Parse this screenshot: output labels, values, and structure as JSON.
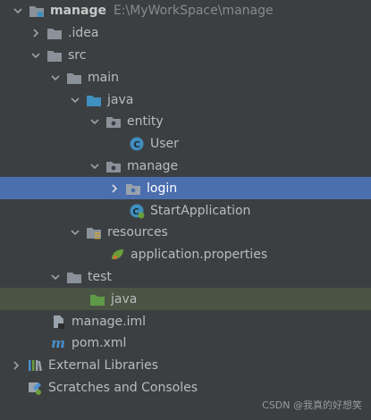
{
  "tree": {
    "root": {
      "label": "manage",
      "path": "E:\\MyWorkSpace\\manage"
    },
    "idea": {
      "label": ".idea"
    },
    "src": {
      "label": "src"
    },
    "main": {
      "label": "main"
    },
    "java": {
      "label": "java"
    },
    "entity": {
      "label": "entity"
    },
    "user": {
      "label": "User"
    },
    "manage_pkg": {
      "label": "manage"
    },
    "login": {
      "label": "login"
    },
    "start_app": {
      "label": "StartApplication"
    },
    "resources": {
      "label": "resources"
    },
    "app_props": {
      "label": "application.properties"
    },
    "test": {
      "label": "test"
    },
    "test_java": {
      "label": "java"
    },
    "manage_iml": {
      "label": "manage.iml"
    },
    "pom": {
      "label": "pom.xml"
    },
    "ext_libs": {
      "label": "External Libraries"
    },
    "scratches": {
      "label": "Scratches and Consoles"
    }
  },
  "watermark": "CSDN @我真的好想笑",
  "colors": {
    "background": "#3c3f41",
    "selection": "#4b6eaf",
    "highlight": "#4a5444",
    "folder": "#8a9199",
    "source_folder": "#3f8fc0",
    "test_folder": "#5f9a48"
  }
}
